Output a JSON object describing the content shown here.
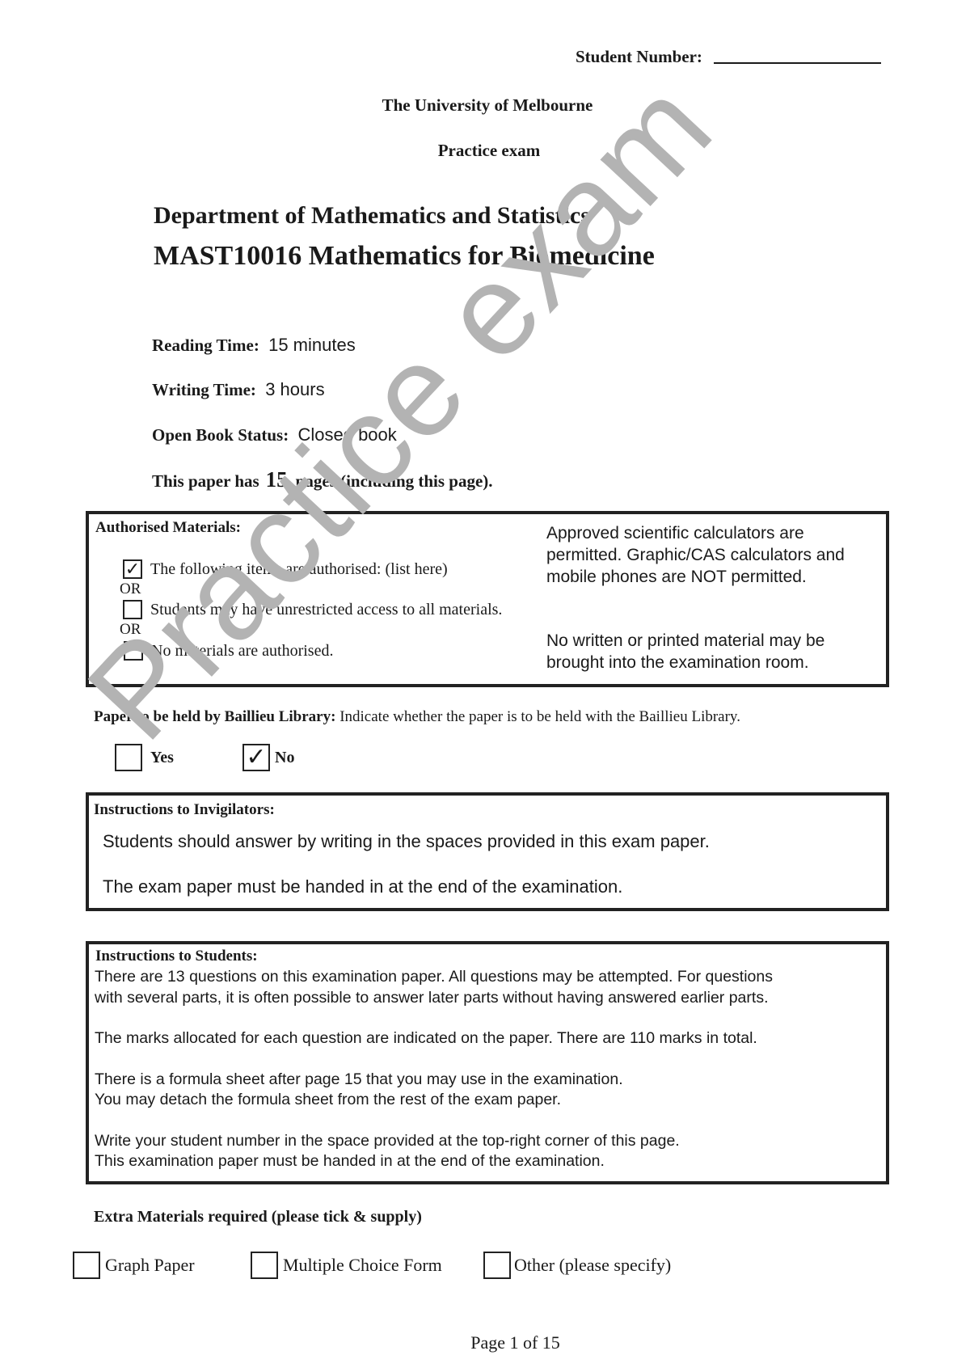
{
  "header": {
    "student_number_label": "Student Number:",
    "student_number_value": "",
    "university": "The University of Melbourne",
    "exam_type": "Practice exam",
    "department": "Department of Mathematics and Statistics",
    "course": "MAST10016 Mathematics for Biomedicine"
  },
  "details": {
    "reading_time_label": "Reading Time:",
    "reading_time_value": "15 minutes",
    "writing_time_label": "Writing Time:",
    "writing_time_value": "3 hours",
    "open_book_label": "Open Book Status:",
    "open_book_value": "Closed book",
    "pages_prefix": "This paper has",
    "pages_count": "15",
    "pages_suffix": "pages (including this page)."
  },
  "authorised_materials": {
    "title": "Authorised Materials:",
    "or_label": "OR",
    "options": [
      {
        "label": "The following items are authorised: (list here)",
        "checked": true
      },
      {
        "label": "Students may have unrestricted access to all materials.",
        "checked": false
      },
      {
        "label": "No materials are authorised.",
        "checked": false
      }
    ],
    "note_1": "Approved scientific calculators are permitted.  Graphic/CAS calculators and mobile phones are NOT permitted.",
    "note_1_lines": [
      "Approved scientific calculators are",
      "permitted.  Graphic/CAS calculators and",
      "mobile phones are NOT permitted."
    ],
    "note_2_lines": [
      "No written or printed material may be",
      "brought into the examination room."
    ]
  },
  "library": {
    "label": "Paper to be held by Baillieu Library:",
    "text": "Indicate whether the paper is to be held with the Baillieu Library.",
    "options": [
      {
        "label": "Yes",
        "checked": false
      },
      {
        "label": "No",
        "checked": true
      }
    ]
  },
  "invigilators": {
    "title": "Instructions to Invigilators:",
    "lines": [
      "Students should answer by writing in the spaces provided in this exam paper.",
      "The exam paper must be handed in at the end of the examination."
    ]
  },
  "students": {
    "title": "Instructions to Students:",
    "lines": [
      "There are 13 questions on this examination paper.  All questions may be attempted.  For questions",
      "with several parts, it is often possible to answer later parts without having answered earlier parts.",
      "The marks allocated for each question are indicated on the paper. There are 110 marks in total.",
      "There is a formula sheet after page 15 that you may use in the examination.",
      "You may detach the formula sheet from the rest of the exam paper.",
      "Write your student number in the space provided at the top-right corner of this page.",
      "This examination paper must be handed in at the end of the examination."
    ]
  },
  "extra_materials": {
    "title": "Extra Materials required (please tick & supply)",
    "options": [
      {
        "label": "Graph Paper",
        "checked": false
      },
      {
        "label": "Multiple Choice Form",
        "checked": false
      },
      {
        "label": "Other (please specify)",
        "checked": false
      }
    ]
  },
  "footer": {
    "page_label": "Page 1 of  15"
  },
  "watermark": {
    "text": "Practice exam",
    "color": "#b3b3b3"
  },
  "icons": {
    "check": "✓"
  }
}
